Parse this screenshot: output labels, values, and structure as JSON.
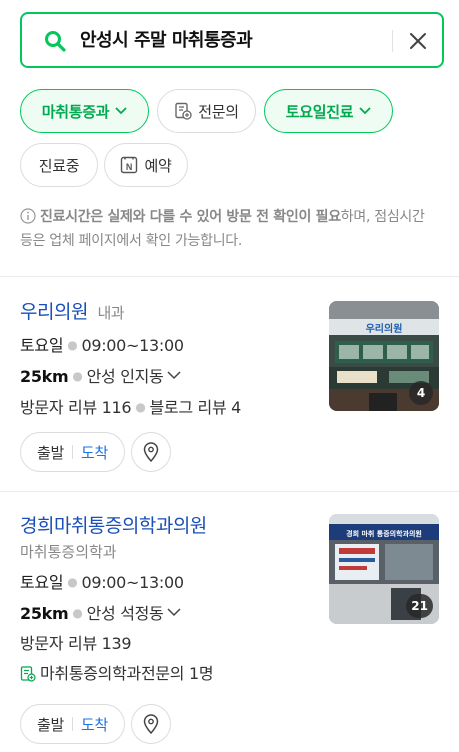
{
  "search": {
    "query": "안성시 주말 마취통증과"
  },
  "filters": [
    {
      "label": "마취통증과",
      "active": true,
      "chevron": true
    },
    {
      "label": "전문의",
      "active": false,
      "icon": "specialist-doc-icon"
    },
    {
      "label": "토요일진료",
      "active": true,
      "chevron": true
    },
    {
      "label": "진료중",
      "active": false
    },
    {
      "label": "예약",
      "active": false,
      "icon": "naver-n-icon"
    }
  ],
  "notice": {
    "bold": "진료시간은 실제와 다를 수 있어 방문 전 확인이 필요",
    "rest": "하며, 점심시간 등은 업체 페이지에서 확인 가능합니다."
  },
  "results": [
    {
      "name": "우리의원",
      "category_inline": "내과",
      "day": "토요일",
      "time": "09:00~13:00",
      "distance": "25km",
      "address": "안성 인지동",
      "visitor_reviews": "방문자 리뷰 116",
      "blog_reviews": "블로그 리뷰 4",
      "start_label": "출발",
      "arrive_label": "도착",
      "photo_count": "4",
      "photo_sign": "우리의원"
    },
    {
      "name": "경희마취통증의학과의원",
      "category_line": "마취통증의학과",
      "day": "토요일",
      "time": "09:00~13:00",
      "distance": "25km",
      "address": "안성 석정동",
      "visitor_reviews": "방문자 리뷰 139",
      "specialist": "마취통증의학과전문의 1명",
      "start_label": "출발",
      "arrive_label": "도착",
      "photo_count": "21",
      "photo_sign": "경희 마취 통증의학과의원"
    }
  ],
  "colors": {
    "brand_green": "#03c75a",
    "link_blue": "#1a4fb8",
    "arrive_blue": "#1a73e8"
  }
}
